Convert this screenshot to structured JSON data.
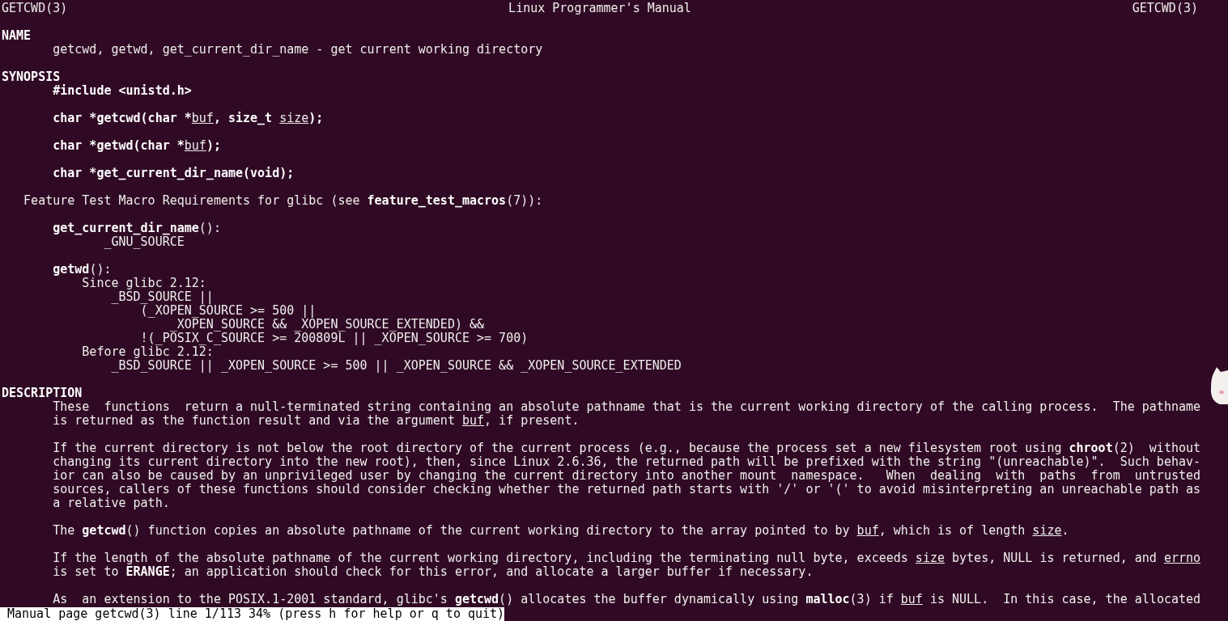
{
  "header": {
    "left": "GETCWD(3)",
    "center": "Linux Programmer's Manual",
    "right": "GETCWD(3)"
  },
  "blocks": [
    [
      {
        "kind": "heading",
        "text": "NAME"
      },
      {
        "kind": "text",
        "segments": [
          {
            "text": "       getcwd, getwd, get_current_dir_name - get current working directory",
            "kind": "plain"
          }
        ]
      }
    ],
    [
      {
        "kind": "heading",
        "text": "SYNOPSIS"
      },
      {
        "kind": "text",
        "segments": [
          {
            "text": "       #include <unistd.h>",
            "kind": "name"
          }
        ]
      }
    ],
    [
      {
        "kind": "text",
        "segments": [
          {
            "text": "       char *getcwd(char *",
            "kind": "name"
          },
          {
            "text": "buf",
            "kind": "argument"
          },
          {
            "text": ", size_t ",
            "kind": "name"
          },
          {
            "text": "size",
            "kind": "argument"
          },
          {
            "text": ");",
            "kind": "name"
          }
        ]
      }
    ],
    [
      {
        "kind": "text",
        "segments": [
          {
            "text": "       char *getwd(char *",
            "kind": "name"
          },
          {
            "text": "buf",
            "kind": "argument"
          },
          {
            "text": ");",
            "kind": "name"
          }
        ]
      }
    ],
    [
      {
        "kind": "text",
        "segments": [
          {
            "text": "       char *get_current_dir_name(void);",
            "kind": "name"
          }
        ]
      }
    ],
    [
      {
        "kind": "text",
        "segments": [
          {
            "text": "   Feature Test Macro Requirements for glibc (see ",
            "kind": "plain"
          },
          {
            "text": "feature_test_macros",
            "kind": "name"
          },
          {
            "text": "(7)):",
            "kind": "plain"
          }
        ]
      }
    ],
    [
      {
        "kind": "text",
        "segments": [
          {
            "text": "       get_current_dir_name",
            "kind": "name"
          },
          {
            "text": "():",
            "kind": "plain"
          }
        ]
      },
      {
        "kind": "text",
        "segments": [
          {
            "text": "              _GNU_SOURCE",
            "kind": "plain"
          }
        ]
      }
    ],
    [
      {
        "kind": "text",
        "segments": [
          {
            "text": "       getwd",
            "kind": "name"
          },
          {
            "text": "():",
            "kind": "plain"
          }
        ]
      },
      {
        "kind": "text",
        "segments": [
          {
            "text": "           Since glibc 2.12:",
            "kind": "plain"
          }
        ]
      },
      {
        "kind": "text",
        "segments": [
          {
            "text": "               _BSD_SOURCE ||",
            "kind": "plain"
          }
        ]
      },
      {
        "kind": "text",
        "segments": [
          {
            "text": "                   (_XOPEN_SOURCE >= 500 ||",
            "kind": "plain"
          }
        ]
      },
      {
        "kind": "text",
        "segments": [
          {
            "text": "                       _XOPEN_SOURCE && _XOPEN_SOURCE_EXTENDED) &&",
            "kind": "plain"
          }
        ]
      },
      {
        "kind": "text",
        "segments": [
          {
            "text": "                   !(_POSIX_C_SOURCE >= 200809L || _XOPEN_SOURCE >= 700)",
            "kind": "plain"
          }
        ]
      },
      {
        "kind": "text",
        "segments": [
          {
            "text": "           Before glibc 2.12:",
            "kind": "plain"
          }
        ]
      },
      {
        "kind": "text",
        "segments": [
          {
            "text": "               _BSD_SOURCE || _XOPEN_SOURCE >= 500 || _XOPEN_SOURCE && _XOPEN_SOURCE_EXTENDED",
            "kind": "plain"
          }
        ]
      }
    ],
    [
      {
        "kind": "heading",
        "text": "DESCRIPTION"
      },
      {
        "kind": "text",
        "segments": [
          {
            "text": "       These  functions  return a null-terminated string containing an absolute pathname that is the current working directory of the calling process.  The pathname",
            "kind": "plain"
          }
        ]
      },
      {
        "kind": "text",
        "segments": [
          {
            "text": "       is returned as the function result and via the argument ",
            "kind": "plain"
          },
          {
            "text": "buf",
            "kind": "argument"
          },
          {
            "text": ", if present.",
            "kind": "plain"
          }
        ]
      }
    ],
    [
      {
        "kind": "text",
        "segments": [
          {
            "text": "       If the current directory is not below the root directory of the current process (e.g., because the process set a new filesystem root using ",
            "kind": "plain"
          },
          {
            "text": "chroot",
            "kind": "name"
          },
          {
            "text": "(2)  without",
            "kind": "plain"
          }
        ]
      },
      {
        "kind": "text",
        "segments": [
          {
            "text": "       changing its current directory into the new root), then, since Linux 2.6.36, the returned path will be prefixed with the string \"(unreachable)\".  Such behav‐",
            "kind": "plain"
          }
        ]
      },
      {
        "kind": "text",
        "segments": [
          {
            "text": "       ior can also be caused by an unprivileged user by changing the current directory into another mount  namespace.   When  dealing  with  paths  from  untrusted",
            "kind": "plain"
          }
        ]
      },
      {
        "kind": "text",
        "segments": [
          {
            "text": "       sources, callers of these functions should consider checking whether the returned path starts with '/' or '(' to avoid misinterpreting an unreachable path as",
            "kind": "plain"
          }
        ]
      },
      {
        "kind": "text",
        "segments": [
          {
            "text": "       a relative path.",
            "kind": "plain"
          }
        ]
      }
    ],
    [
      {
        "kind": "text",
        "segments": [
          {
            "text": "       The ",
            "kind": "plain"
          },
          {
            "text": "getcwd",
            "kind": "name"
          },
          {
            "text": "() function copies an absolute pathname of the current working directory to the array pointed to by ",
            "kind": "plain"
          },
          {
            "text": "buf",
            "kind": "argument"
          },
          {
            "text": ", which is of length ",
            "kind": "plain"
          },
          {
            "text": "size",
            "kind": "argument"
          },
          {
            "text": ".",
            "kind": "plain"
          }
        ]
      }
    ],
    [
      {
        "kind": "text",
        "segments": [
          {
            "text": "       If the length of the absolute pathname of the current working directory, including the terminating null byte, exceeds ",
            "kind": "plain"
          },
          {
            "text": "size",
            "kind": "argument"
          },
          {
            "text": " bytes, NULL is returned, and ",
            "kind": "plain"
          },
          {
            "text": "errno",
            "kind": "argument"
          }
        ]
      },
      {
        "kind": "text",
        "segments": [
          {
            "text": "       is set to ",
            "kind": "plain"
          },
          {
            "text": "ERANGE",
            "kind": "name"
          },
          {
            "text": "; an application should check for this error, and allocate a larger buffer if necessary.",
            "kind": "plain"
          }
        ]
      }
    ],
    [
      {
        "kind": "text",
        "segments": [
          {
            "text": "       As  an extension to the POSIX.1-2001 standard, glibc's ",
            "kind": "plain"
          },
          {
            "text": "getcwd",
            "kind": "name"
          },
          {
            "text": "() allocates the buffer dynamically using ",
            "kind": "plain"
          },
          {
            "text": "malloc",
            "kind": "name"
          },
          {
            "text": "(3) if ",
            "kind": "plain"
          },
          {
            "text": "buf",
            "kind": "argument"
          },
          {
            "text": " is NULL.  In this case, the allocated",
            "kind": "plain"
          }
        ]
      }
    ]
  ],
  "status_line": "Manual page getcwd(3) line 1/113 34% (press h for help or q to quit)"
}
